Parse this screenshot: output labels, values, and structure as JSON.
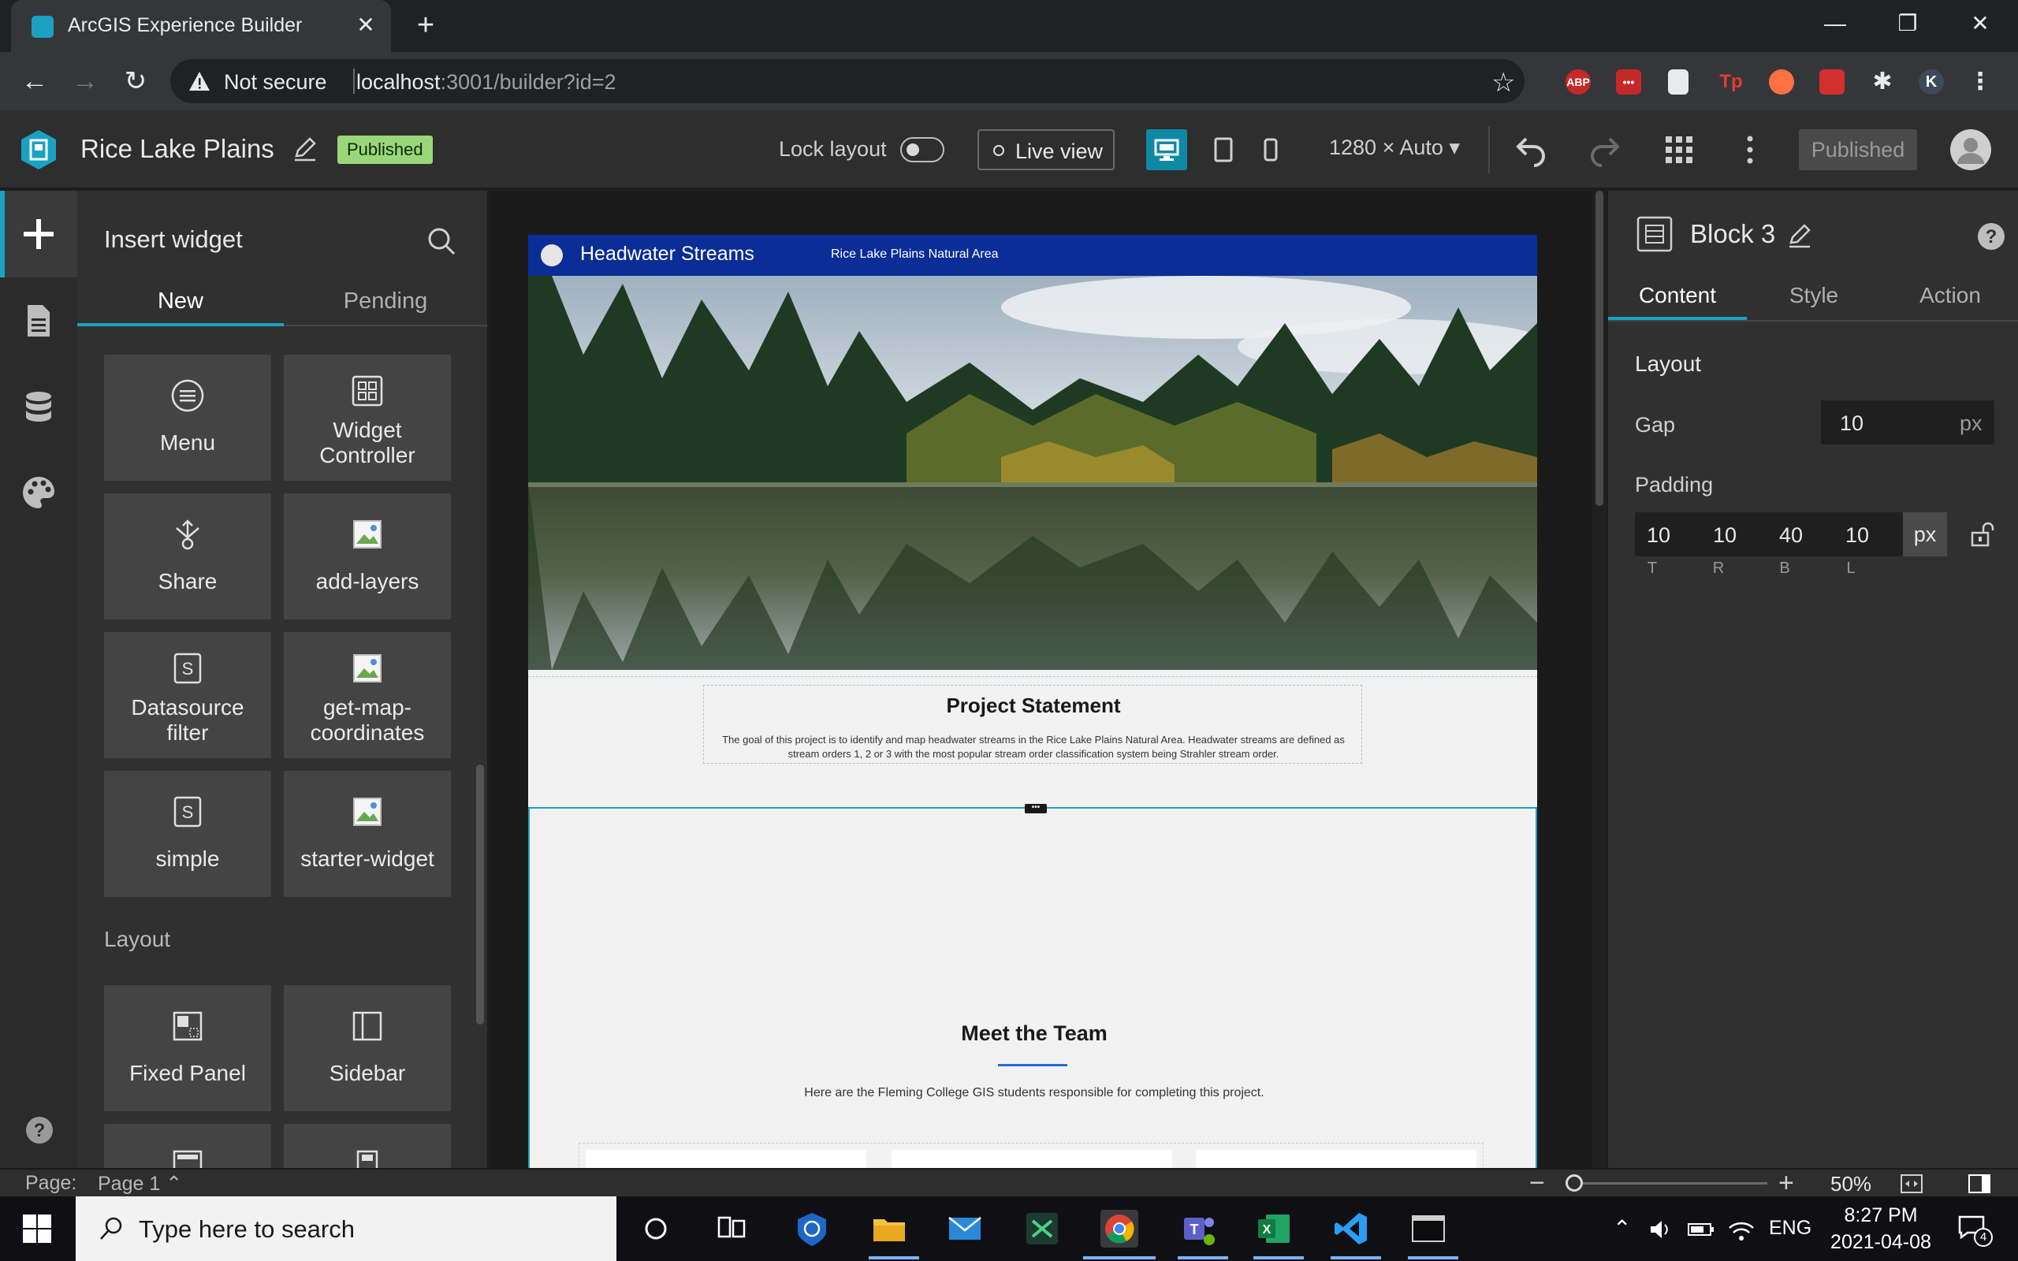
{
  "browser": {
    "tab_title": "ArcGIS Experience Builder",
    "not_secure": "Not secure",
    "url_host": "localhost",
    "url_rest": ":3001/builder?id=2",
    "extensions": [
      "ABP",
      "•••",
      "",
      "Tp",
      "",
      "",
      "",
      "K"
    ]
  },
  "header": {
    "app_title": "Rice Lake Plains",
    "status_badge": "Published",
    "lock_layout_label": "Lock layout",
    "live_view_label": "Live view",
    "screen_size": "1280 × Auto",
    "publish_button": "Published"
  },
  "widget_panel": {
    "title": "Insert widget",
    "tabs": [
      {
        "label": "New"
      },
      {
        "label": "Pending"
      }
    ],
    "widgets": [
      {
        "label": "Menu",
        "icon": "menu-icon"
      },
      {
        "label": "Widget Controller",
        "icon": "widget-controller-icon"
      },
      {
        "label": "Share",
        "icon": "share-icon"
      },
      {
        "label": "add-layers",
        "icon": "image-placeholder-icon"
      },
      {
        "label": "Datasource filter",
        "icon": "s-box-icon"
      },
      {
        "label": "get-map-coordinates",
        "icon": "image-placeholder-icon"
      },
      {
        "label": "simple",
        "icon": "s-box-icon"
      },
      {
        "label": "starter-widget",
        "icon": "image-placeholder-icon"
      }
    ],
    "layout_heading": "Layout",
    "layout_widgets": [
      {
        "label": "Fixed Panel",
        "icon": "fixed-panel-icon"
      },
      {
        "label": "Sidebar",
        "icon": "sidebar-icon"
      }
    ]
  },
  "canvas": {
    "header_title": "Headwater Streams",
    "header_subtitle": "Rice Lake Plains Natural Area",
    "project_title": "Project Statement",
    "project_text": "The goal of this project is to identify and map headwater streams in the Rice Lake Plains Natural Area. Headwater streams are defined as stream orders 1, 2 or 3 with the most popular stream order classification system being Strahler stream order.",
    "team_title": "Meet the Team",
    "team_sub": "Here are the Fleming College GIS students responsible for completing this project."
  },
  "settings": {
    "block_title": "Block 3",
    "tabs": [
      {
        "label": "Content"
      },
      {
        "label": "Style"
      },
      {
        "label": "Action"
      }
    ],
    "layout_heading": "Layout",
    "gap_label": "Gap",
    "gap_value": "10",
    "gap_unit": "px",
    "padding_label": "Padding",
    "padding": [
      {
        "value": "10",
        "side": "T"
      },
      {
        "value": "10",
        "side": "R"
      },
      {
        "value": "40",
        "side": "B"
      },
      {
        "value": "10",
        "side": "L"
      }
    ],
    "padding_unit": "px"
  },
  "footer": {
    "page_label": "Page:",
    "page_value": "Page 1",
    "zoom": "50%",
    "zoom_fraction": 0.02
  },
  "taskbar": {
    "search_placeholder": "Type here to search",
    "language": "ENG",
    "time": "8:27 PM",
    "date": "2021-04-08",
    "notification_count": "4"
  },
  "colors": {
    "accent": "#1ba1c2",
    "published_badge": "#9ad77a",
    "page_header": "#0a2e96",
    "block_selection": "#1ba1c2"
  }
}
